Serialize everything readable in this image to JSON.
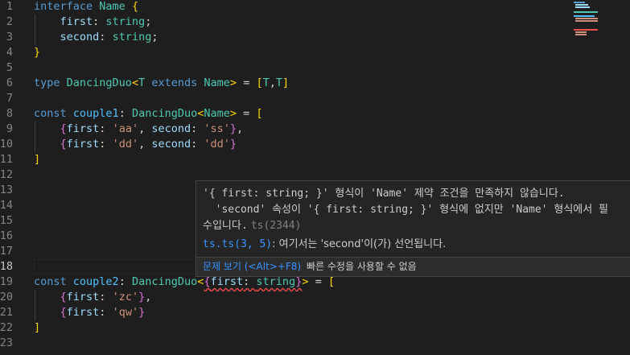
{
  "editor": {
    "line_numbers": [
      "1",
      "2",
      "3",
      "4",
      "5",
      "6",
      "7",
      "8",
      "9",
      "10",
      "11",
      "12",
      "13",
      "14",
      "15",
      "16",
      "17",
      "18",
      "19",
      "20",
      "21",
      "22",
      "23"
    ],
    "active_line": "18",
    "lines": [
      [
        {
          "t": "interface",
          "c": "#569cd6"
        },
        {
          "t": " "
        },
        {
          "t": "Name",
          "c": "#4ec9b0"
        },
        {
          "t": " "
        },
        {
          "t": "{",
          "c": "#ffd700"
        }
      ],
      [
        {
          "t": "    "
        },
        {
          "t": "first",
          "c": "#9cdcfe"
        },
        {
          "t": ": "
        },
        {
          "t": "string",
          "c": "#4ec9b0"
        },
        {
          "t": ";"
        }
      ],
      [
        {
          "t": "    "
        },
        {
          "t": "second",
          "c": "#9cdcfe"
        },
        {
          "t": ": "
        },
        {
          "t": "string",
          "c": "#4ec9b0"
        },
        {
          "t": ";"
        }
      ],
      [
        {
          "t": "}",
          "c": "#ffd700"
        }
      ],
      [],
      [
        {
          "t": "type",
          "c": "#569cd6"
        },
        {
          "t": " "
        },
        {
          "t": "DancingDuo",
          "c": "#4ec9b0"
        },
        {
          "t": "<",
          "c": "#ffd700"
        },
        {
          "t": "T",
          "c": "#4ec9b0"
        },
        {
          "t": " "
        },
        {
          "t": "extends",
          "c": "#569cd6"
        },
        {
          "t": " "
        },
        {
          "t": "Name",
          "c": "#4ec9b0"
        },
        {
          "t": ">",
          "c": "#ffd700"
        },
        {
          "t": " = "
        },
        {
          "t": "[",
          "c": "#ffd700"
        },
        {
          "t": "T",
          "c": "#4ec9b0"
        },
        {
          "t": ","
        },
        {
          "t": "T",
          "c": "#4ec9b0"
        },
        {
          "t": "]",
          "c": "#ffd700"
        }
      ],
      [],
      [
        {
          "t": "const",
          "c": "#569cd6"
        },
        {
          "t": " "
        },
        {
          "t": "couple1",
          "c": "#4fc1ff"
        },
        {
          "t": ": "
        },
        {
          "t": "DancingDuo",
          "c": "#4ec9b0"
        },
        {
          "t": "<",
          "c": "#ffd700"
        },
        {
          "t": "Name",
          "c": "#4ec9b0"
        },
        {
          "t": ">",
          "c": "#ffd700"
        },
        {
          "t": " = "
        },
        {
          "t": "[",
          "c": "#ffd700"
        }
      ],
      [
        {
          "t": "    "
        },
        {
          "t": "{",
          "c": "#da70d6"
        },
        {
          "t": "first",
          "c": "#9cdcfe"
        },
        {
          "t": ": "
        },
        {
          "t": "'aa'",
          "c": "#ce9178"
        },
        {
          "t": ", "
        },
        {
          "t": "second",
          "c": "#9cdcfe"
        },
        {
          "t": ": "
        },
        {
          "t": "'ss'",
          "c": "#ce9178"
        },
        {
          "t": "}",
          "c": "#da70d6"
        },
        {
          "t": ","
        }
      ],
      [
        {
          "t": "    "
        },
        {
          "t": "{",
          "c": "#da70d6"
        },
        {
          "t": "first",
          "c": "#9cdcfe"
        },
        {
          "t": ": "
        },
        {
          "t": "'dd'",
          "c": "#ce9178"
        },
        {
          "t": ", "
        },
        {
          "t": "second",
          "c": "#9cdcfe"
        },
        {
          "t": ": "
        },
        {
          "t": "'dd'",
          "c": "#ce9178"
        },
        {
          "t": "}",
          "c": "#da70d6"
        }
      ],
      [
        {
          "t": "]",
          "c": "#ffd700"
        }
      ],
      [],
      [],
      [],
      [],
      [],
      [],
      [],
      [
        {
          "t": "const",
          "c": "#569cd6"
        },
        {
          "t": " "
        },
        {
          "t": "couple2",
          "c": "#4fc1ff"
        },
        {
          "t": ": "
        },
        {
          "t": "DancingDuo",
          "c": "#4ec9b0"
        },
        {
          "t": "<",
          "c": "#ffd700"
        },
        {
          "t": "{",
          "c": "#da70d6",
          "sq": true
        },
        {
          "t": "first",
          "c": "#9cdcfe",
          "sq": true
        },
        {
          "t": ": ",
          "sq": true
        },
        {
          "t": "string",
          "c": "#4ec9b0",
          "sq": true
        },
        {
          "t": "}",
          "c": "#da70d6",
          "sq": true
        },
        {
          "t": ">",
          "c": "#ffd700"
        },
        {
          "t": " = "
        },
        {
          "t": "[",
          "c": "#ffd700"
        }
      ],
      [
        {
          "t": "    "
        },
        {
          "t": "{",
          "c": "#da70d6"
        },
        {
          "t": "first",
          "c": "#9cdcfe"
        },
        {
          "t": ": "
        },
        {
          "t": "'zc'",
          "c": "#ce9178"
        },
        {
          "t": "}",
          "c": "#da70d6"
        },
        {
          "t": ","
        }
      ],
      [
        {
          "t": "    "
        },
        {
          "t": "{",
          "c": "#da70d6"
        },
        {
          "t": "first",
          "c": "#9cdcfe"
        },
        {
          "t": ": "
        },
        {
          "t": "'qw'",
          "c": "#ce9178"
        },
        {
          "t": "}",
          "c": "#da70d6"
        }
      ],
      [
        {
          "t": "]",
          "c": "#ffd700"
        }
      ],
      []
    ]
  },
  "hover": {
    "message_line1": "'{ first: string; }' 형식이 'Name' 제약 조건을 만족하지 않습니다.",
    "message_line2": "  'second' 속성이 '{ first: string; }' 형식에 없지만 'Name' 형식에서 필",
    "message_line3": "수입니다.",
    "error_code": "ts(2344)",
    "related_link": "ts.ts(3, 5)",
    "related_text": ": 여기서는 'second'이(가) 선언됩니다.",
    "view_problem": "문제 보기 (<Alt>+F8)",
    "no_quick_fix": "빠른 수정을 사용할 수 없음"
  },
  "colors": {
    "background": "#1e1e1e",
    "keyword": "#569cd6",
    "type": "#4ec9b0",
    "property": "#9cdcfe",
    "string": "#ce9178",
    "bracket_gold": "#ffd700",
    "bracket_orchid": "#da70d6",
    "error": "#f14c4c",
    "link": "#3794ff"
  }
}
